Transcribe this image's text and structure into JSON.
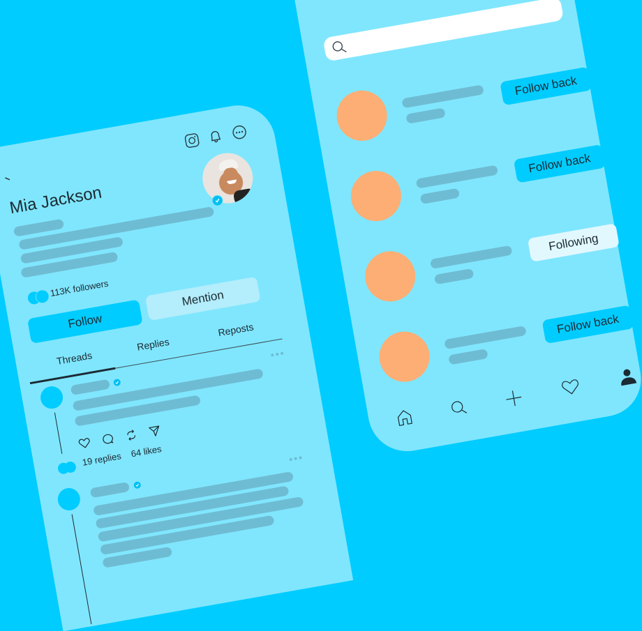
{
  "profile": {
    "name": "Mia Jackson",
    "verified": true,
    "followers_label": "113K followers",
    "header_icons": [
      "instagram-icon",
      "bell-icon",
      "more-icon"
    ],
    "follow_label": "Follow",
    "mention_label": "Mention",
    "tabs": [
      {
        "label": "Threads",
        "active": true
      },
      {
        "label": "Replies",
        "active": false
      },
      {
        "label": "Reposts",
        "active": false
      }
    ],
    "posts": [
      {
        "verified": true,
        "replies_label": "19 replies",
        "likes_label": "64 likes",
        "actions": [
          "heart-icon",
          "comment-icon",
          "repost-icon",
          "send-icon"
        ]
      },
      {
        "verified": true
      }
    ]
  },
  "search": {
    "placeholder": ""
  },
  "follow_list": [
    {
      "button_label": "Follow back",
      "state": "follow-back"
    },
    {
      "button_label": "Follow back",
      "state": "follow-back"
    },
    {
      "button_label": "Following",
      "state": "following"
    },
    {
      "button_label": "Follow back",
      "state": "follow-back"
    }
  ],
  "bottom_nav": [
    {
      "icon": "home-icon",
      "active": false
    },
    {
      "icon": "search-icon",
      "active": false
    },
    {
      "icon": "plus-icon",
      "active": false
    },
    {
      "icon": "heart-icon",
      "active": false
    },
    {
      "icon": "profile-icon",
      "active": true
    }
  ],
  "colors": {
    "background": "#00CCFF",
    "card": "#80E6FD",
    "placeholder_bar": "#6EBCD3",
    "accent": "#00CCFF",
    "avatar_placeholder": "#FCAE74",
    "following_button": "#E2F8FF"
  }
}
